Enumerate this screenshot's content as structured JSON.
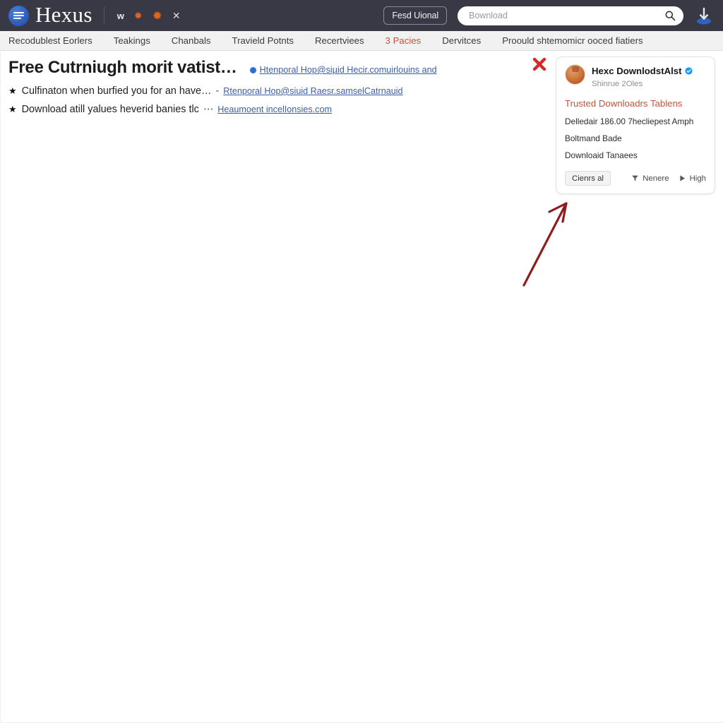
{
  "header": {
    "brand_name": "Hexus",
    "logo_icon": "hexus-logo-icon",
    "mini_icons": [
      {
        "name": "w-icon",
        "glyph": "w"
      },
      {
        "name": "star-icon-1",
        "glyph": "✹"
      },
      {
        "name": "star-icon-2",
        "glyph": "✹"
      },
      {
        "name": "close-x-icon",
        "glyph": "✕"
      }
    ],
    "action_button_label": "Fesd Uional",
    "search": {
      "placeholder": "Bownload",
      "value": "",
      "icon": "search-icon"
    },
    "download_avatar_icon": "download-avatar-icon",
    "background_color": "#393945"
  },
  "nav": {
    "items": [
      {
        "label": "Recodublest Eorlers",
        "accent": false
      },
      {
        "label": "Teakings",
        "accent": false
      },
      {
        "label": "Chanbals",
        "accent": false
      },
      {
        "label": "Travield Potnts",
        "accent": false
      },
      {
        "label": "Recertviees",
        "accent": false
      },
      {
        "label": "3 Pacies",
        "accent": true
      },
      {
        "label": "Dervitces",
        "accent": false
      },
      {
        "label": "Proould shtemomicr ooced fiatiers",
        "accent": false
      }
    ],
    "accent_color": "#c4553c",
    "background_color": "#f1f1f1"
  },
  "main": {
    "headline": "Free Cutrniugh morit vatist…",
    "headline_link": "Htenporal Hop@siµid Hecir.comuirlouins and",
    "bullets": [
      {
        "text": "Culfinaton when burfied you for an have…",
        "separator": "-",
        "link": "Rtenporal Hop@siuid Raesr.samselCatrnauid"
      },
      {
        "text": "Download atill yalues heverid banies tlc",
        "separator": "⋯",
        "link": "Heaumoent incelIonsies.com"
      }
    ],
    "link_color": "#3b5fa8",
    "close_icon": "close-icon",
    "annotation_arrow_icon": "annotation-arrow-icon",
    "annotation_color": "#8f1d1d"
  },
  "card": {
    "avatar_icon": "profile-avatar-icon",
    "title": "Hexc DownlodstAlst",
    "verified_icon": "verified-badge-icon",
    "subtitle": "Shinrue 2Oles",
    "accent_heading": "Trusted Downloadrs Tablens",
    "lines": [
      "Delledair 186.00 7hecliepest Amph",
      "Boltmand Bade",
      "Downloaid Tanaees"
    ],
    "primary_button_label": "Cienrs al",
    "actions": [
      {
        "icon": "filter-funnel-icon",
        "label": "Nenere"
      },
      {
        "icon": "play-triangle-icon",
        "label": "High"
      }
    ],
    "accent_color": "#c4553c",
    "verified_color": "#1d9bf0"
  }
}
